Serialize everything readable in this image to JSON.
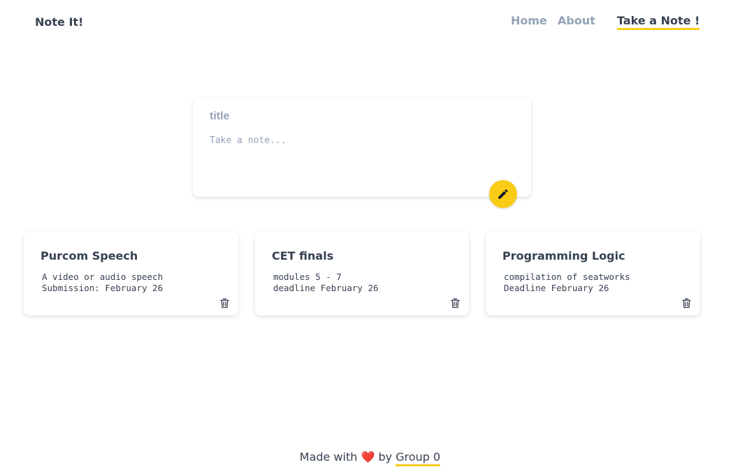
{
  "header": {
    "brand": "Note It!",
    "nav": {
      "home": "Home",
      "about": "About",
      "take_note": "Take a Note !"
    }
  },
  "composer": {
    "title_placeholder": "title",
    "body_placeholder": "Take a note...",
    "add_icon": "pencil-icon"
  },
  "notes": [
    {
      "title": "Purcom Speech",
      "line1": "A video or audio speech",
      "line2": "Submission: February 26",
      "delete_icon": "trash-icon"
    },
    {
      "title": "CET finals",
      "line1": "modules 5 - 7",
      "line2": "deadline February 26",
      "delete_icon": "trash-icon"
    },
    {
      "title": "Programming Logic",
      "line1": "compilation of seatworks",
      "line2": "Deadline February 26",
      "delete_icon": "trash-icon"
    }
  ],
  "footer": {
    "made_with": "Made with",
    "heart": "❤️",
    "by": "by",
    "link": "Group 0"
  },
  "colors": {
    "accent": "#facc15",
    "text": "#374151",
    "muted": "#94a3b8"
  }
}
